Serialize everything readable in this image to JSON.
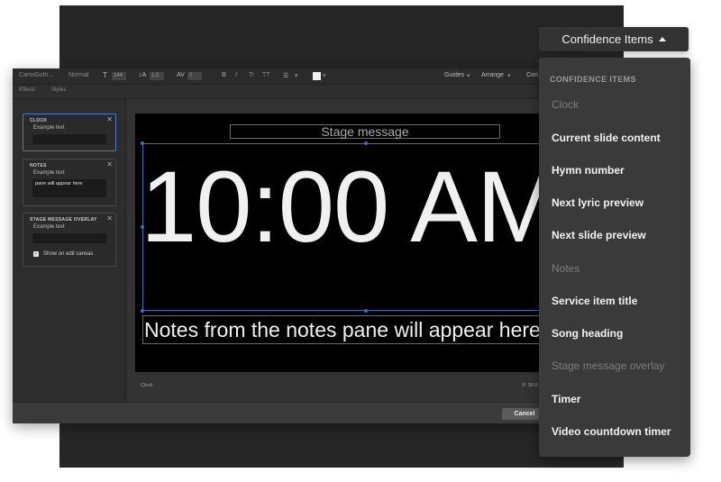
{
  "toolbar": {
    "font_name": "CartoGoth...",
    "font_weight": "Normal",
    "font_size": "144",
    "line_height": "1.0",
    "tracking": "0",
    "bold": "B",
    "italic": "I",
    "tr": "Tr",
    "tt": "TT",
    "align_icon": "☰",
    "guides": "Guides",
    "arrange": "Arrange",
    "con": "Con",
    "effects": "Effects",
    "styles": "Styles"
  },
  "sidebar": {
    "clock": {
      "title": "CLOCK",
      "label": "Example text",
      "value": ""
    },
    "notes": {
      "title": "NOTES",
      "label": "Example text",
      "value": "pane will appear here"
    },
    "stage_message": {
      "title": "STAGE MESSAGE OVERLAY",
      "label": "Example text",
      "value": "",
      "checkbox_label": "Show on edit canvas",
      "checked": true
    }
  },
  "canvas": {
    "stage_message": "Stage message",
    "clock": "10:00 AM",
    "notes": "Notes from the notes pane will appear here"
  },
  "canvas_footer": {
    "left": "Clock",
    "right": "X: 30.0"
  },
  "bottom_bar": {
    "cancel": "Cancel"
  },
  "confidence_button": {
    "label": "Confidence Items"
  },
  "menu": {
    "heading": "CONFIDENCE ITEMS",
    "items": [
      {
        "label": "Clock",
        "enabled": false
      },
      {
        "label": "Current slide content",
        "enabled": true
      },
      {
        "label": "Hymn number",
        "enabled": true
      },
      {
        "label": "Next lyric preview",
        "enabled": true
      },
      {
        "label": "Next slide preview",
        "enabled": true
      },
      {
        "label": "Notes",
        "enabled": false
      },
      {
        "label": "Service item title",
        "enabled": true
      },
      {
        "label": "Song heading",
        "enabled": true
      },
      {
        "label": "Stage message overlay",
        "enabled": false
      },
      {
        "label": "Timer",
        "enabled": true
      },
      {
        "label": "Video countdown timer",
        "enabled": true
      }
    ]
  },
  "colors": {
    "accent_blue": "#3e6fb8",
    "menu_bg": "#3a3a3a",
    "disabled_text": "#7d7d7d"
  }
}
